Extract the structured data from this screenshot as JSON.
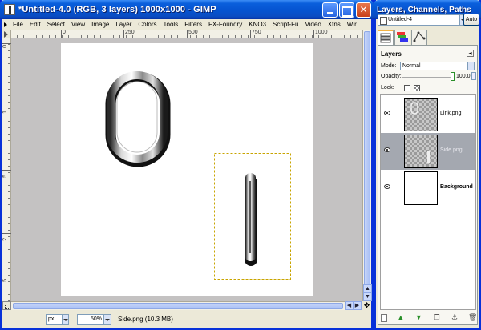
{
  "main_window": {
    "title": "*Untitled-4.0 (RGB, 3 layers) 1000x1000 - GIMP",
    "menu": [
      {
        "label": "File"
      },
      {
        "label": "Edit"
      },
      {
        "label": "Select"
      },
      {
        "label": "View"
      },
      {
        "label": "Image"
      },
      {
        "label": "Layer"
      },
      {
        "label": "Colors"
      },
      {
        "label": "Tools"
      },
      {
        "label": "Filters"
      },
      {
        "label": "FX-Foundry"
      },
      {
        "label": "KNO3"
      },
      {
        "label": "Script-Fu"
      },
      {
        "label": "Video"
      },
      {
        "label": "Xtns"
      },
      {
        "label": "Wir"
      }
    ],
    "ruler_h_labels": [
      "0",
      "250",
      "500",
      "750",
      "1000"
    ],
    "ruler_v_labels": [
      "0",
      "1",
      "5",
      "2",
      "5"
    ],
    "status": {
      "unit": "px",
      "zoom": "50%",
      "message": "Side.png (10.3 MB)"
    }
  },
  "layers_dock": {
    "title": "Layers, Channels, Paths",
    "image_select": "Untitled-4",
    "auto_label": "Auto",
    "panel_title": "Layers",
    "mode_label": "Mode:",
    "mode_value": "Normal",
    "opacity_label": "Opacity:",
    "opacity_value": "100.0",
    "lock_label": "Lock:",
    "layers": [
      {
        "name": "Link.png",
        "selected": false
      },
      {
        "name": "Side.png",
        "selected": true
      },
      {
        "name": "Background",
        "selected": false
      }
    ]
  },
  "colors": {
    "titlebar": "#0a5fdc",
    "window_border": "#0831d9",
    "canvas_bg": "#c4c2c2",
    "selection": "#a4a8b0"
  }
}
